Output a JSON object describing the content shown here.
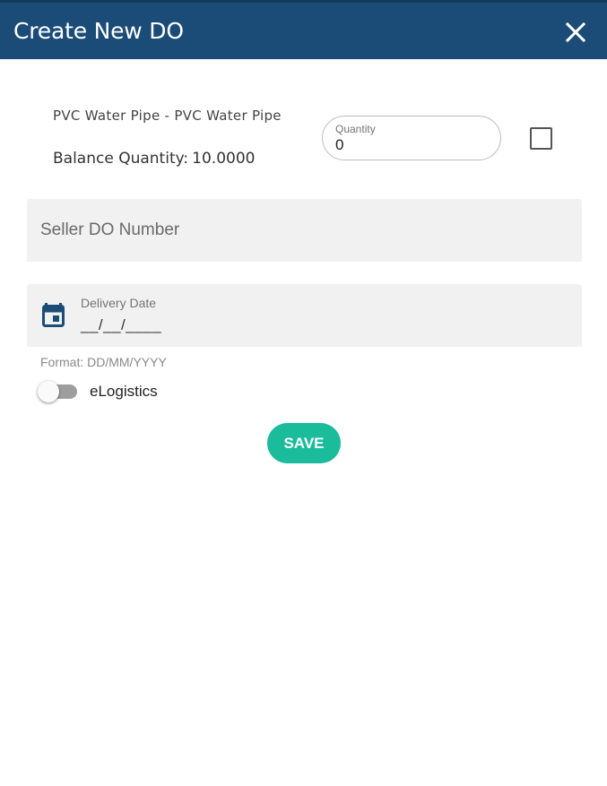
{
  "dialog": {
    "title": "Create New DO",
    "close_icon": "close-icon"
  },
  "item": {
    "name": "PVC Water Pipe - PVC Water Pipe",
    "balance_label": "Balance Quantity:",
    "balance_value": "10.0000",
    "quantity_label": "Quantity",
    "quantity_value": "0",
    "selected": false
  },
  "seller_do": {
    "placeholder": "Seller DO Number"
  },
  "delivery_date": {
    "icon": "calendar-icon",
    "label": "Delivery Date",
    "value": "__/__/____",
    "hint": "Format: DD/MM/YYYY"
  },
  "elogistics": {
    "label": "eLogistics",
    "enabled": false
  },
  "actions": {
    "save_label": "SAVE"
  },
  "colors": {
    "header": "#1a4c77",
    "accent": "#1abc9c",
    "field_bg": "#f1f1f1"
  }
}
